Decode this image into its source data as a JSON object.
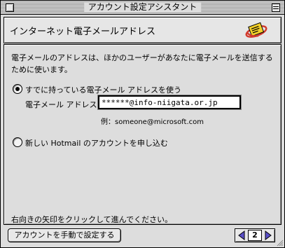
{
  "window": {
    "title": "アカウント設定アシスタント"
  },
  "header": {
    "title": "インターネット電子メールアドレス",
    "icon": "email-card-icon"
  },
  "content": {
    "description": "電子メールのアドレスは、ほかのユーザーがあなたに電子メールを送信するために使います。",
    "options": [
      {
        "label": "すでに持っている電子メール アドレスを使う",
        "selected": true
      },
      {
        "label": "新しい Hotmail のアカウントを申し込む",
        "selected": false
      }
    ],
    "email": {
      "label": "電子メール アドレス：",
      "value": "******@info-niigata.or.jp",
      "example": "例：someone@microsoft.com"
    },
    "hint": "右向きの矢印をクリックして進んでください。"
  },
  "footer": {
    "manual_button": "アカウントを手動で設定する",
    "page_number": "2",
    "prev_icon": "left-arrow-icon",
    "next_icon": "right-arrow-icon"
  },
  "colors": {
    "arrow": "#5a4fc8",
    "icon_yellow": "#f2cf2a",
    "icon_red": "#d23b2e"
  }
}
